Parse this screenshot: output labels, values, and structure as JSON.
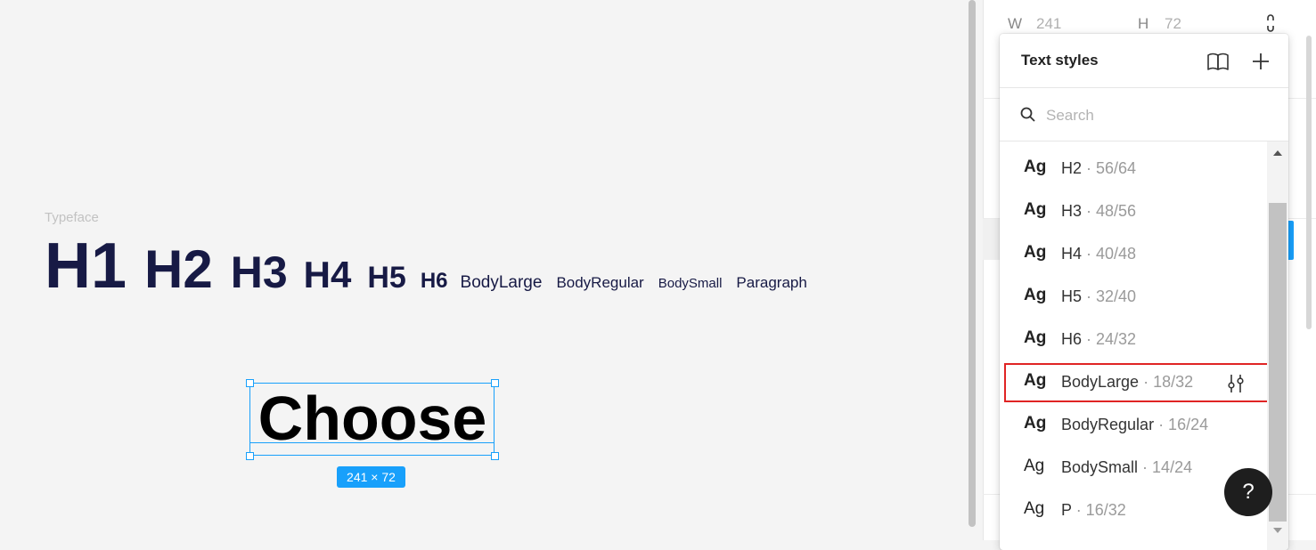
{
  "canvas": {
    "typeface_label": "Typeface",
    "samples": [
      "H1",
      "H2",
      "H3",
      "H4",
      "H5",
      "H6",
      "BodyLarge",
      "BodyRegular",
      "BodySmall",
      "Paragraph"
    ],
    "selected_text": "Choose",
    "size_badge": "241 × 72"
  },
  "design_panel": {
    "w_label": "W",
    "w_value": "241",
    "h_label": "H",
    "h_value": "72"
  },
  "text_styles_popup": {
    "title": "Text styles",
    "search_placeholder": "Search",
    "items": [
      {
        "ag": "Ag",
        "name": "H2",
        "meta": " · 56/64"
      },
      {
        "ag": "Ag",
        "name": "H3",
        "meta": " · 48/56"
      },
      {
        "ag": "Ag",
        "name": "H4",
        "meta": " · 40/48"
      },
      {
        "ag": "Ag",
        "name": "H5",
        "meta": " · 32/40"
      },
      {
        "ag": "Ag",
        "name": "H6",
        "meta": " · 24/32"
      },
      {
        "ag": "Ag",
        "name": "BodyLarge",
        "meta": " · 18/32"
      },
      {
        "ag": "Ag",
        "name": "BodyRegular",
        "meta": " · 16/24"
      },
      {
        "ag": "Ag",
        "name": "BodySmall",
        "meta": " · 14/24"
      },
      {
        "ag": "Ag",
        "name": "P",
        "meta": " · 16/32"
      }
    ]
  },
  "help": {
    "label": "?"
  },
  "colors": {
    "accent": "#18a0fb",
    "highlight": "#e02424",
    "type_color": "#171a45"
  }
}
